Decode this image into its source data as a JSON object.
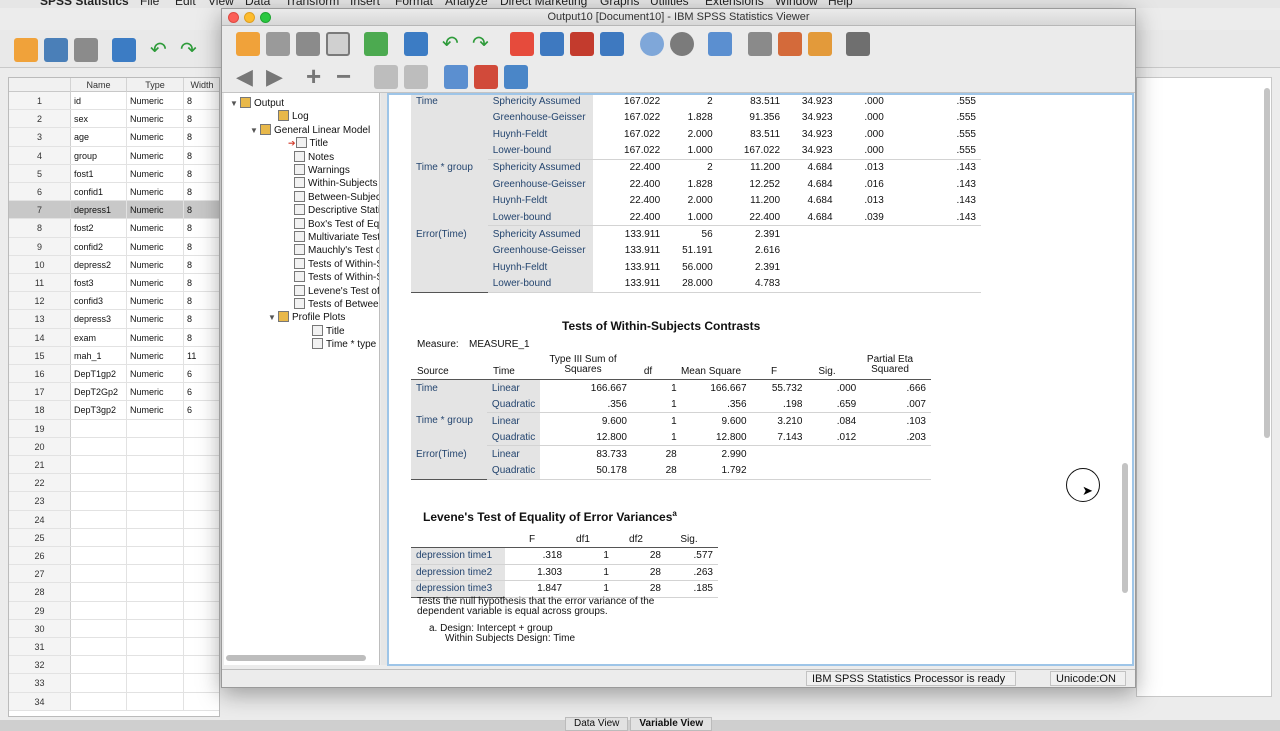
{
  "menubar": {
    "app": "SPSS Statistics",
    "items": [
      "File",
      "Edit",
      "View",
      "Data",
      "Transform",
      "Insert",
      "Format",
      "Analyze",
      "Direct Marketing",
      "Graphs",
      "Utilities",
      "Extensions",
      "Window",
      "Help"
    ]
  },
  "data_editor": {
    "columns": [
      "Name",
      "Type",
      "Width"
    ],
    "rows": [
      {
        "n": "1",
        "name": "id",
        "type": "Numeric",
        "width": "8"
      },
      {
        "n": "2",
        "name": "sex",
        "type": "Numeric",
        "width": "8"
      },
      {
        "n": "3",
        "name": "age",
        "type": "Numeric",
        "width": "8"
      },
      {
        "n": "4",
        "name": "group",
        "type": "Numeric",
        "width": "8"
      },
      {
        "n": "5",
        "name": "fost1",
        "type": "Numeric",
        "width": "8"
      },
      {
        "n": "6",
        "name": "confid1",
        "type": "Numeric",
        "width": "8"
      },
      {
        "n": "7",
        "name": "depress1",
        "type": "Numeric",
        "width": "8"
      },
      {
        "n": "8",
        "name": "fost2",
        "type": "Numeric",
        "width": "8"
      },
      {
        "n": "9",
        "name": "confid2",
        "type": "Numeric",
        "width": "8"
      },
      {
        "n": "10",
        "name": "depress2",
        "type": "Numeric",
        "width": "8"
      },
      {
        "n": "11",
        "name": "fost3",
        "type": "Numeric",
        "width": "8"
      },
      {
        "n": "12",
        "name": "confid3",
        "type": "Numeric",
        "width": "8"
      },
      {
        "n": "13",
        "name": "depress3",
        "type": "Numeric",
        "width": "8"
      },
      {
        "n": "14",
        "name": "exam",
        "type": "Numeric",
        "width": "8"
      },
      {
        "n": "15",
        "name": "mah_1",
        "type": "Numeric",
        "width": "11"
      },
      {
        "n": "16",
        "name": "DepT1gp2",
        "type": "Numeric",
        "width": "6"
      },
      {
        "n": "17",
        "name": "DepT2Gp2",
        "type": "Numeric",
        "width": "6"
      },
      {
        "n": "18",
        "name": "DepT3gp2",
        "type": "Numeric",
        "width": "6"
      },
      {
        "n": "19",
        "name": "",
        "type": "",
        "width": ""
      },
      {
        "n": "20",
        "name": "",
        "type": "",
        "width": ""
      },
      {
        "n": "21",
        "name": "",
        "type": "",
        "width": ""
      },
      {
        "n": "22",
        "name": "",
        "type": "",
        "width": ""
      },
      {
        "n": "23",
        "name": "",
        "type": "",
        "width": ""
      },
      {
        "n": "24",
        "name": "",
        "type": "",
        "width": ""
      },
      {
        "n": "25",
        "name": "",
        "type": "",
        "width": ""
      },
      {
        "n": "26",
        "name": "",
        "type": "",
        "width": ""
      },
      {
        "n": "27",
        "name": "",
        "type": "",
        "width": ""
      },
      {
        "n": "28",
        "name": "",
        "type": "",
        "width": ""
      },
      {
        "n": "29",
        "name": "",
        "type": "",
        "width": ""
      },
      {
        "n": "30",
        "name": "",
        "type": "",
        "width": ""
      },
      {
        "n": "31",
        "name": "",
        "type": "",
        "width": ""
      },
      {
        "n": "32",
        "name": "",
        "type": "",
        "width": ""
      },
      {
        "n": "33",
        "name": "",
        "type": "",
        "width": ""
      },
      {
        "n": "34",
        "name": "",
        "type": "",
        "width": ""
      }
    ],
    "selected_row": "7",
    "tabs": [
      "Data View",
      "Variable View"
    ]
  },
  "viewer": {
    "title": "Output10 [Document10] - IBM SPSS Statistics Viewer",
    "outline": [
      {
        "label": "Output",
        "level": 0,
        "tri": "▼"
      },
      {
        "label": "Log",
        "level": 2,
        "tri": ""
      },
      {
        "label": "General Linear Model",
        "level": 1,
        "tri": "▼"
      },
      {
        "label": "Title",
        "level": 3,
        "tri": "",
        "arrow": "➔"
      },
      {
        "label": "Notes",
        "level": 3,
        "tri": ""
      },
      {
        "label": "Warnings",
        "level": 3,
        "tri": ""
      },
      {
        "label": "Within-Subjects F",
        "level": 3,
        "tri": ""
      },
      {
        "label": "Between-Subject",
        "level": 3,
        "tri": ""
      },
      {
        "label": "Descriptive Statis",
        "level": 3,
        "tri": ""
      },
      {
        "label": "Box's Test of Equ",
        "level": 3,
        "tri": ""
      },
      {
        "label": "Multivariate Test:",
        "level": 3,
        "tri": ""
      },
      {
        "label": "Mauchly's Test of",
        "level": 3,
        "tri": ""
      },
      {
        "label": "Tests of Within-S",
        "level": 3,
        "tri": ""
      },
      {
        "label": "Tests of Within-S",
        "level": 3,
        "tri": ""
      },
      {
        "label": "Levene's Test of",
        "level": 3,
        "tri": ""
      },
      {
        "label": "Tests of Between",
        "level": 3,
        "tri": ""
      },
      {
        "label": "Profile Plots",
        "level": 2,
        "tri": "▼"
      },
      {
        "label": "Title",
        "level": 4,
        "tri": ""
      },
      {
        "label": "Time * type",
        "level": 4,
        "tri": ""
      }
    ],
    "status": {
      "processor": "IBM SPSS Statistics Processor is ready",
      "unicode": "Unicode:ON"
    }
  },
  "within_effects": {
    "rows": [
      [
        "Time",
        "Sphericity Assumed",
        "167.022",
        "2",
        "83.511",
        "34.923",
        ".000",
        ".555"
      ],
      [
        "",
        "Greenhouse-Geisser",
        "167.022",
        "1.828",
        "91.356",
        "34.923",
        ".000",
        ".555"
      ],
      [
        "",
        "Huynh-Feldt",
        "167.022",
        "2.000",
        "83.511",
        "34.923",
        ".000",
        ".555"
      ],
      [
        "",
        "Lower-bound",
        "167.022",
        "1.000",
        "167.022",
        "34.923",
        ".000",
        ".555"
      ],
      [
        "Time * group",
        "Sphericity Assumed",
        "22.400",
        "2",
        "11.200",
        "4.684",
        ".013",
        ".143"
      ],
      [
        "",
        "Greenhouse-Geisser",
        "22.400",
        "1.828",
        "12.252",
        "4.684",
        ".016",
        ".143"
      ],
      [
        "",
        "Huynh-Feldt",
        "22.400",
        "2.000",
        "11.200",
        "4.684",
        ".013",
        ".143"
      ],
      [
        "",
        "Lower-bound",
        "22.400",
        "1.000",
        "22.400",
        "4.684",
        ".039",
        ".143"
      ],
      [
        "Error(Time)",
        "Sphericity Assumed",
        "133.911",
        "56",
        "2.391",
        "",
        "",
        ""
      ],
      [
        "",
        "Greenhouse-Geisser",
        "133.911",
        "51.191",
        "2.616",
        "",
        "",
        ""
      ],
      [
        "",
        "Huynh-Feldt",
        "133.911",
        "56.000",
        "2.391",
        "",
        "",
        ""
      ],
      [
        "",
        "Lower-bound",
        "133.911",
        "28.000",
        "4.783",
        "",
        "",
        ""
      ]
    ]
  },
  "contrasts": {
    "title": "Tests of Within-Subjects Contrasts",
    "measure_label": "Measure:",
    "measure_value": "MEASURE_1",
    "headers": {
      "source": "Source",
      "time": "Time",
      "ss": "Type III Sum of Squares",
      "df": "df",
      "ms": "Mean Square",
      "f": "F",
      "sig": "Sig.",
      "eta": "Partial Eta Squared"
    },
    "rows": [
      [
        "Time",
        "Linear",
        "166.667",
        "1",
        "166.667",
        "55.732",
        ".000",
        ".666"
      ],
      [
        "",
        "Quadratic",
        ".356",
        "1",
        ".356",
        ".198",
        ".659",
        ".007"
      ],
      [
        "Time * group",
        "Linear",
        "9.600",
        "1",
        "9.600",
        "3.210",
        ".084",
        ".103"
      ],
      [
        "",
        "Quadratic",
        "12.800",
        "1",
        "12.800",
        "7.143",
        ".012",
        ".203"
      ],
      [
        "Error(Time)",
        "Linear",
        "83.733",
        "28",
        "2.990",
        "",
        "",
        ""
      ],
      [
        "",
        "Quadratic",
        "50.178",
        "28",
        "1.792",
        "",
        "",
        ""
      ]
    ]
  },
  "levene": {
    "title": "Levene's Test of Equality of Error Variances",
    "sup": "a",
    "headers": [
      "F",
      "df1",
      "df2",
      "Sig."
    ],
    "rows": [
      [
        "depression time1",
        ".318",
        "1",
        "28",
        ".577"
      ],
      [
        "depression time2",
        "1.303",
        "1",
        "28",
        ".263"
      ],
      [
        "depression time3",
        "1.847",
        "1",
        "28",
        ".185"
      ]
    ],
    "note1": "Tests the null hypothesis that the error variance of the",
    "note2": "dependent variable is equal across groups.",
    "note3": "a. Design: Intercept + group",
    "note4": "Within Subjects Design: Time"
  },
  "colors": {
    "accent": "#9ec5e8",
    "row_header": "#e4e4e4",
    "label_text": "#24456f"
  }
}
